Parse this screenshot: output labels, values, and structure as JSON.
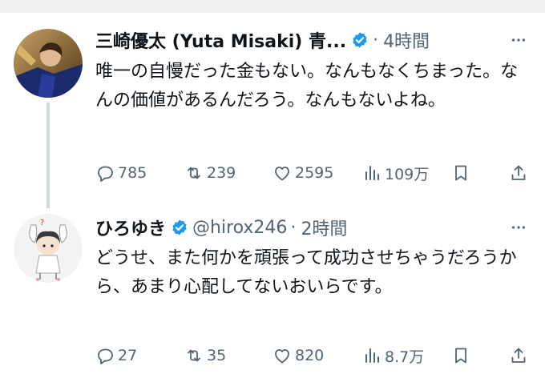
{
  "tweets": [
    {
      "author": "三崎優太 (Yuta Misaki) 青...",
      "time": "4時間",
      "text": "唯一の自慢だった金もない。なんもなくちまった。なんの価値があるんだろう。なんもないよね。",
      "replies": "785",
      "retweets": "239",
      "likes": "2595",
      "views": "109万"
    },
    {
      "author": "ひろゆき",
      "handle": "@hirox246",
      "time": "2時間",
      "text": "どうせ、また何かを頑張って成功させちゃうだろうから、あまり心配してないおいらです。",
      "replies": "27",
      "retweets": "35",
      "likes": "820",
      "views": "8.7万"
    }
  ],
  "separator": "·",
  "icons": {
    "verified": "verified-badge-icon",
    "more": "more-dots-icon",
    "reply": "reply-icon",
    "retweet": "retweet-icon",
    "like": "heart-icon",
    "views": "views-chart-icon",
    "bookmark": "bookmark-icon",
    "share": "share-icon"
  },
  "colors": {
    "verified": "#1d9bf0",
    "text": "#0f1419",
    "secondary": "#536471",
    "thread_line": "#cfd9de"
  }
}
